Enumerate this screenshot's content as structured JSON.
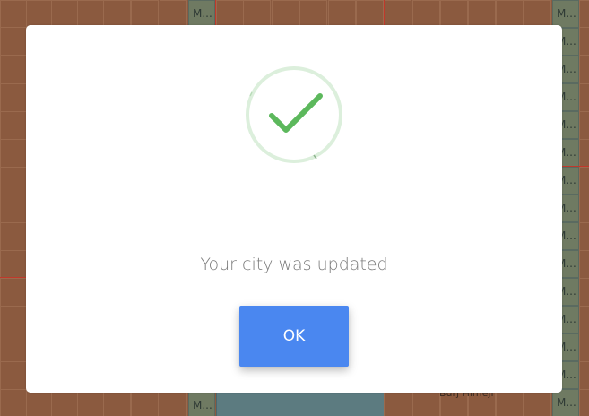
{
  "background": {
    "strip_label": "M...",
    "city_label": "Burj Himeji"
  },
  "dialog": {
    "icon": "checkmark-icon",
    "message": "Your city was updated",
    "ok_label": "OK",
    "colors": {
      "check": "#5cb85c",
      "ring": "#dcefdc",
      "button": "#4a87f0"
    }
  }
}
